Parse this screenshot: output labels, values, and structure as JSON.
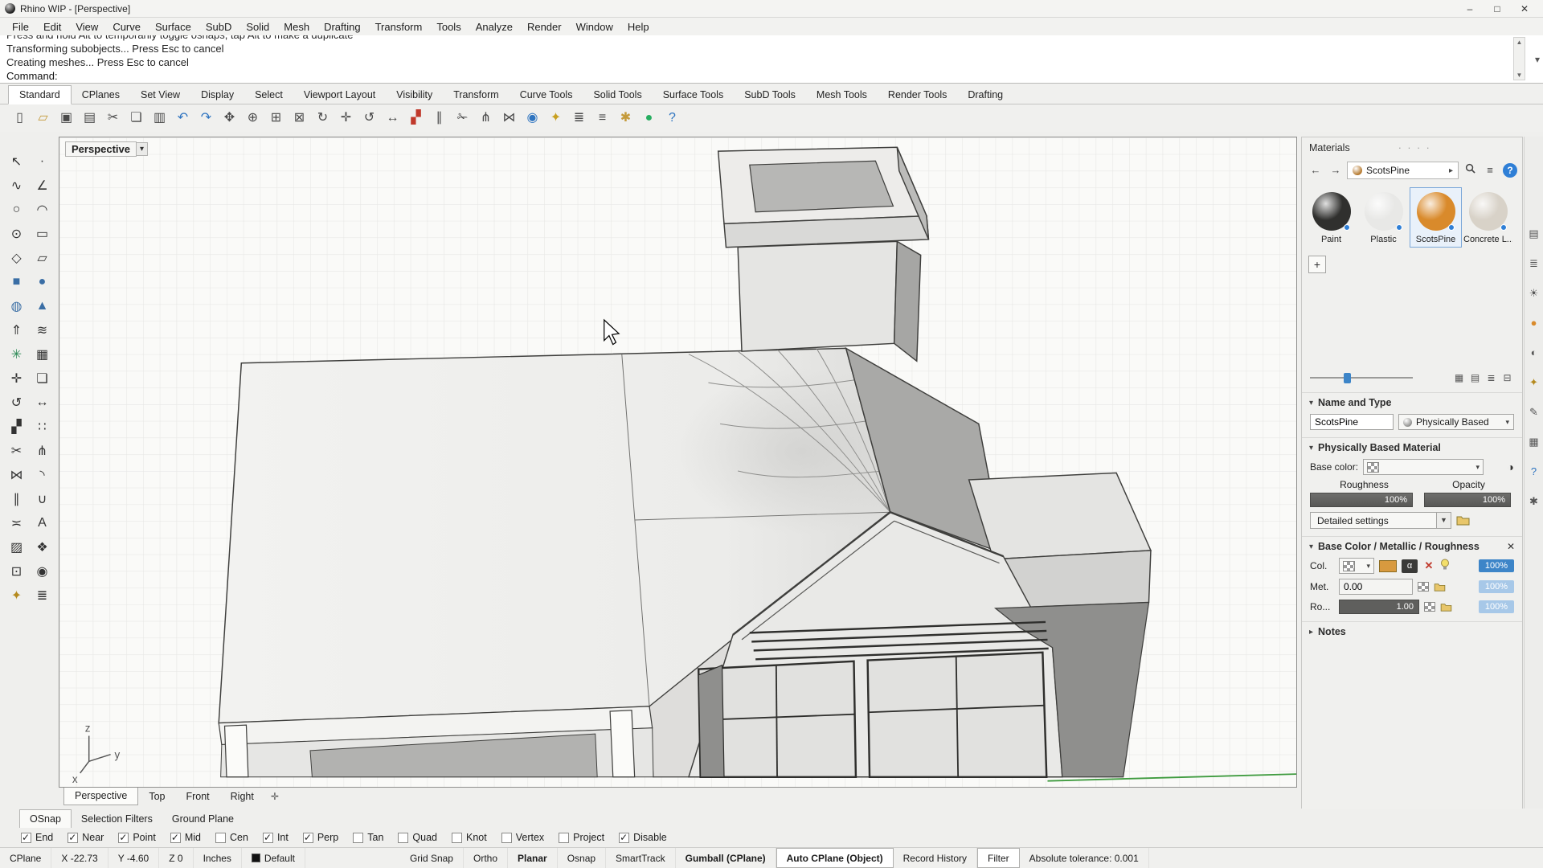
{
  "colors": {
    "accent_blue": "#3d85c8",
    "selection_orange": "#d98a2b",
    "viewport_green_axis": "#3f9b3f"
  },
  "window": {
    "title": "Rhino WIP - [Perspective]",
    "controls": [
      {
        "name": "minimize-button",
        "glyph": "–"
      },
      {
        "name": "maximize-button",
        "glyph": "□"
      },
      {
        "name": "close-button",
        "glyph": "✕"
      }
    ]
  },
  "menu": {
    "items": [
      {
        "label": "File"
      },
      {
        "label": "Edit"
      },
      {
        "label": "View"
      },
      {
        "label": "Curve"
      },
      {
        "label": "Surface"
      },
      {
        "label": "SubD"
      },
      {
        "label": "Solid"
      },
      {
        "label": "Mesh"
      },
      {
        "label": "Drafting"
      },
      {
        "label": "Transform"
      },
      {
        "label": "Tools"
      },
      {
        "label": "Analyze"
      },
      {
        "label": "Render"
      },
      {
        "label": "Window"
      },
      {
        "label": "Help"
      }
    ]
  },
  "command": {
    "history": [
      {
        "text": "Press and hold Alt to temporarily toggle osnaps, tap Alt to make a duplicate"
      },
      {
        "text": "Transforming subobjects... Press Esc to cancel"
      },
      {
        "text": "Creating meshes... Press Esc to cancel"
      }
    ],
    "prompt": "Command:",
    "scroll_up_glyph": "▲",
    "scroll_down_glyph": "▼",
    "expand_glyph": "▾"
  },
  "toolbar_tabs": [
    {
      "label": "Standard",
      "active": true
    },
    {
      "label": "CPlanes"
    },
    {
      "label": "Set View"
    },
    {
      "label": "Display"
    },
    {
      "label": "Select"
    },
    {
      "label": "Viewport Layout"
    },
    {
      "label": "Visibility"
    },
    {
      "label": "Transform"
    },
    {
      "label": "Curve Tools"
    },
    {
      "label": "Solid Tools"
    },
    {
      "label": "Surface Tools"
    },
    {
      "label": "SubD Tools"
    },
    {
      "label": "Mesh Tools"
    },
    {
      "label": "Render Tools"
    },
    {
      "label": "Drafting"
    }
  ],
  "toolbar_icons": [
    {
      "name": "new-file-icon",
      "glyph": "▯",
      "color": "#4a4a4a"
    },
    {
      "name": "open-file-icon",
      "glyph": "▱",
      "color": "#c49a3a"
    },
    {
      "name": "save-icon",
      "glyph": "▣",
      "color": "#4a4a4a"
    },
    {
      "name": "print-icon",
      "glyph": "▤",
      "color": "#4a4a4a"
    },
    {
      "name": "cut-icon",
      "glyph": "✂",
      "color": "#4a4a4a"
    },
    {
      "name": "copy-icon",
      "glyph": "❏",
      "color": "#4a4a4a"
    },
    {
      "name": "paste-icon",
      "glyph": "▥",
      "color": "#4a4a4a"
    },
    {
      "name": "undo-icon",
      "glyph": "↶",
      "color": "#2e74c0"
    },
    {
      "name": "redo-icon",
      "glyph": "↷",
      "color": "#2e74c0"
    },
    {
      "name": "pan-icon",
      "glyph": "✥",
      "color": "#4a4a4a"
    },
    {
      "name": "zoom-dynamic-icon",
      "glyph": "⊕",
      "color": "#4a4a4a"
    },
    {
      "name": "zoom-window-icon",
      "glyph": "⊞",
      "color": "#4a4a4a"
    },
    {
      "name": "zoom-extents-icon",
      "glyph": "⊠",
      "color": "#4a4a4a"
    },
    {
      "name": "rotate-view-icon",
      "glyph": "↻",
      "color": "#4a4a4a"
    },
    {
      "name": "move-icon",
      "glyph": "✛",
      "color": "#4a4a4a"
    },
    {
      "name": "rotate-icon",
      "glyph": "↺",
      "color": "#4a4a4a"
    },
    {
      "name": "scale-icon",
      "glyph": "↔",
      "color": "#4a4a4a"
    },
    {
      "name": "mirror-icon",
      "glyph": "▞",
      "color": "#c0392b"
    },
    {
      "name": "offset-icon",
      "glyph": "∥",
      "color": "#4a4a4a"
    },
    {
      "name": "trim-icon",
      "glyph": "✁",
      "color": "#4a4a4a"
    },
    {
      "name": "split-icon",
      "glyph": "⋔",
      "color": "#4a4a4a"
    },
    {
      "name": "join-icon",
      "glyph": "⋈",
      "color": "#4a4a4a"
    },
    {
      "name": "record-history-icon",
      "glyph": "◉",
      "color": "#2e74c0"
    },
    {
      "name": "lock-icon",
      "glyph": "✦",
      "color": "#c8a020"
    },
    {
      "name": "layers-icon",
      "glyph": "≣",
      "color": "#4a4a4a"
    },
    {
      "name": "properties-icon",
      "glyph": "≡",
      "color": "#4a4a4a"
    },
    {
      "name": "options-icon",
      "glyph": "✱",
      "color": "#c49a3a"
    },
    {
      "name": "render-icon",
      "glyph": "●",
      "color": "#27ae60"
    },
    {
      "name": "help-icon",
      "glyph": "?",
      "color": "#2e74c0"
    }
  ],
  "left_toolbar": [
    {
      "name": "select-tool-icon",
      "glyph": "↖",
      "color": "#333333"
    },
    {
      "name": "point-tool-icon",
      "glyph": "∙",
      "color": "#333333"
    },
    {
      "name": "curve-tool-icon",
      "glyph": "∿",
      "color": "#333333"
    },
    {
      "name": "polyline-tool-icon",
      "glyph": "∠",
      "color": "#333333"
    },
    {
      "name": "circle-tool-icon",
      "glyph": "○",
      "color": "#333333"
    },
    {
      "name": "arc-tool-icon",
      "glyph": "◠",
      "color": "#333333"
    },
    {
      "name": "ellipse-tool-icon",
      "glyph": "⊙",
      "color": "#333333"
    },
    {
      "name": "rectangle-tool-icon",
      "glyph": "▭",
      "color": "#333333"
    },
    {
      "name": "polygon-tool-icon",
      "glyph": "◇",
      "color": "#333333"
    },
    {
      "name": "plane-tool-icon",
      "glyph": "▱",
      "color": "#333333"
    },
    {
      "name": "box-tool-icon",
      "glyph": "■",
      "color": "#3a6ea5"
    },
    {
      "name": "sphere-tool-icon",
      "glyph": "●",
      "color": "#3a6ea5"
    },
    {
      "name": "cylinder-tool-icon",
      "glyph": "◍",
      "color": "#3a6ea5"
    },
    {
      "name": "cone-tool-icon",
      "glyph": "▲",
      "color": "#3a6ea5"
    },
    {
      "name": "extrude-tool-icon",
      "glyph": "⇑",
      "color": "#333333"
    },
    {
      "name": "loft-tool-icon",
      "glyph": "≋",
      "color": "#333333"
    },
    {
      "name": "subd-tool-icon",
      "glyph": "✳",
      "color": "#2e8b57"
    },
    {
      "name": "mesh-tool-icon",
      "glyph": "▦",
      "color": "#333333"
    },
    {
      "name": "move-tool-icon",
      "glyph": "✛",
      "color": "#333333"
    },
    {
      "name": "copy-tool-icon",
      "glyph": "❏",
      "color": "#333333"
    },
    {
      "name": "rotate-tool-icon",
      "glyph": "↺",
      "color": "#333333"
    },
    {
      "name": "scale-tool-icon",
      "glyph": "↔",
      "color": "#333333"
    },
    {
      "name": "mirror-tool-icon",
      "glyph": "▞",
      "color": "#333333"
    },
    {
      "name": "array-tool-icon",
      "glyph": "∷",
      "color": "#333333"
    },
    {
      "name": "trim-tool-icon",
      "glyph": "✂",
      "color": "#333333"
    },
    {
      "name": "split-tool-icon",
      "glyph": "⋔",
      "color": "#333333"
    },
    {
      "name": "join-tool-icon",
      "glyph": "⋈",
      "color": "#333333"
    },
    {
      "name": "fillet-tool-icon",
      "glyph": "◝",
      "color": "#333333"
    },
    {
      "name": "offset-tool-icon",
      "glyph": "∥",
      "color": "#333333"
    },
    {
      "name": "boolean-tool-icon",
      "glyph": "∪",
      "color": "#333333"
    },
    {
      "name": "dimension-tool-icon",
      "glyph": "≍",
      "color": "#333333"
    },
    {
      "name": "text-tool-icon",
      "glyph": "A",
      "color": "#333333"
    },
    {
      "name": "hatch-tool-icon",
      "glyph": "▨",
      "color": "#333333"
    },
    {
      "name": "block-tool-icon",
      "glyph": "❖",
      "color": "#333333"
    },
    {
      "name": "group-tool-icon",
      "glyph": "⊡",
      "color": "#333333"
    },
    {
      "name": "visibility-tool-icon",
      "glyph": "◉",
      "color": "#333333"
    },
    {
      "name": "lock-tool-icon",
      "glyph": "✦",
      "color": "#b58a1e"
    },
    {
      "name": "layer-tool-icon",
      "glyph": "≣",
      "color": "#333333"
    }
  ],
  "viewport": {
    "label": "Perspective",
    "label_arrow": "▾",
    "axis": {
      "x": "x",
      "y": "y",
      "z": "z"
    },
    "tabs": [
      {
        "label": "Perspective",
        "active": true
      },
      {
        "label": "Top"
      },
      {
        "label": "Front"
      },
      {
        "label": "Right"
      }
    ],
    "new_viewport_glyph": "✛"
  },
  "materials_panel": {
    "title": "Materials",
    "drag_dots": "· · · ·",
    "toolbar": {
      "back_glyph": "←",
      "forward_glyph": "→",
      "breadcrumb": "ScotsPine",
      "breadcrumb_arrow": "▸",
      "menu_glyph": "≡",
      "help_glyph": "?"
    },
    "materials": [
      {
        "name": "material-paint",
        "label": "Paint",
        "color": "#30302e"
      },
      {
        "name": "material-plastic",
        "label": "Plastic",
        "color": "#e8e8e6"
      },
      {
        "name": "material-scotspine",
        "label": "ScotsPine",
        "color": "#d98a2b",
        "selected": true
      },
      {
        "name": "material-concrete",
        "label": "Concrete L...",
        "color": "#d8d2c8"
      }
    ],
    "add_glyph": "+",
    "view_buttons": [
      {
        "name": "grid-view-icon",
        "glyph": "▦"
      },
      {
        "name": "list-view-icon",
        "glyph": "▤"
      },
      {
        "name": "detail-view-icon",
        "glyph": "≣"
      },
      {
        "name": "compact-view-icon",
        "glyph": "⊟"
      }
    ],
    "sections": {
      "name_type": {
        "chevron": "▾",
        "header": "Name and Type",
        "name_value": "ScotsPine",
        "type_value": "Physically Based",
        "type_arrow": "▾"
      },
      "pbm": {
        "chevron": "▾",
        "header": "Physically Based Material",
        "base_color_label": "Base color:",
        "base_color_arrow": "▾",
        "contrast_glyph": "◑",
        "roughness_label": "Roughness",
        "opacity_label": "Opacity",
        "roughness_value": "100%",
        "opacity_value": "100%",
        "detailed_label": "Detailed settings",
        "detailed_arrow": "▼"
      },
      "bcmr": {
        "chevron": "▾",
        "header": "Base Color /  Metallic / Roughness",
        "close_glyph": "✕",
        "col_label": "Col.",
        "col_arrow": "▾",
        "alpha_glyph": "α",
        "delete_glyph": "✕",
        "col_percent": "100%",
        "met_label": "Met.",
        "met_value": "0.00",
        "met_percent": "100%",
        "ro_label": "Ro...",
        "ro_value": "1.00",
        "ro_percent": "100%"
      },
      "notes": {
        "chevron": "▸",
        "header": "Notes"
      }
    }
  },
  "side_strip": [
    {
      "name": "panel-properties-icon",
      "glyph": "▤",
      "color": "#555555"
    },
    {
      "name": "panel-layers-icon",
      "glyph": "≣",
      "color": "#555555"
    },
    {
      "name": "panel-display-icon",
      "glyph": "☀",
      "color": "#555555"
    },
    {
      "name": "panel-materials-icon",
      "glyph": "●",
      "color": "#d98a2b"
    },
    {
      "name": "panel-rendering-icon",
      "glyph": "◐",
      "color": "#555555"
    },
    {
      "name": "panel-lights-icon",
      "glyph": "✦",
      "color": "#b58a1e"
    },
    {
      "name": "panel-notes-icon",
      "glyph": "✎",
      "color": "#555555"
    },
    {
      "name": "panel-libraries-icon",
      "glyph": "▦",
      "color": "#555555"
    },
    {
      "name": "panel-help-icon",
      "glyph": "?",
      "color": "#2e74c0"
    },
    {
      "name": "panel-settings-icon",
      "glyph": "✱",
      "color": "#555555"
    }
  ],
  "osnap": {
    "tabs": [
      {
        "label": "OSnap",
        "active": true
      },
      {
        "label": "Selection Filters"
      },
      {
        "label": "Ground Plane"
      }
    ],
    "snaps": [
      {
        "label": "End",
        "checked": true
      },
      {
        "label": "Near",
        "checked": true
      },
      {
        "label": "Point",
        "checked": true
      },
      {
        "label": "Mid",
        "checked": true
      },
      {
        "label": "Cen"
      },
      {
        "label": "Int",
        "checked": true
      },
      {
        "label": "Perp",
        "checked": true
      },
      {
        "label": "Tan"
      },
      {
        "label": "Quad"
      },
      {
        "label": "Knot"
      },
      {
        "label": "Vertex"
      },
      {
        "label": "Project"
      },
      {
        "label": "Disable",
        "checked": true
      }
    ]
  },
  "status_bar": {
    "left": [
      {
        "label": "CPlane"
      },
      {
        "label": "X -22.73",
        "static": true
      },
      {
        "label": "Y -4.60",
        "static": true
      },
      {
        "label": "Z 0",
        "static": true
      },
      {
        "label": "Inches"
      },
      {
        "label": "Default",
        "swatch": "#111111"
      }
    ],
    "right": [
      {
        "label": "Grid Snap"
      },
      {
        "label": "Ortho"
      },
      {
        "label": "Planar",
        "bold": true
      },
      {
        "label": "Osnap"
      },
      {
        "label": "SmartTrack"
      },
      {
        "label": "Gumball (CPlane)",
        "bold": true
      },
      {
        "label": "Auto CPlane (Object)",
        "bold": true,
        "active": true
      },
      {
        "label": "Record History"
      },
      {
        "label": "Filter",
        "active": true
      },
      {
        "label": "Absolute tolerance: 0.001",
        "static": true
      }
    ]
  }
}
